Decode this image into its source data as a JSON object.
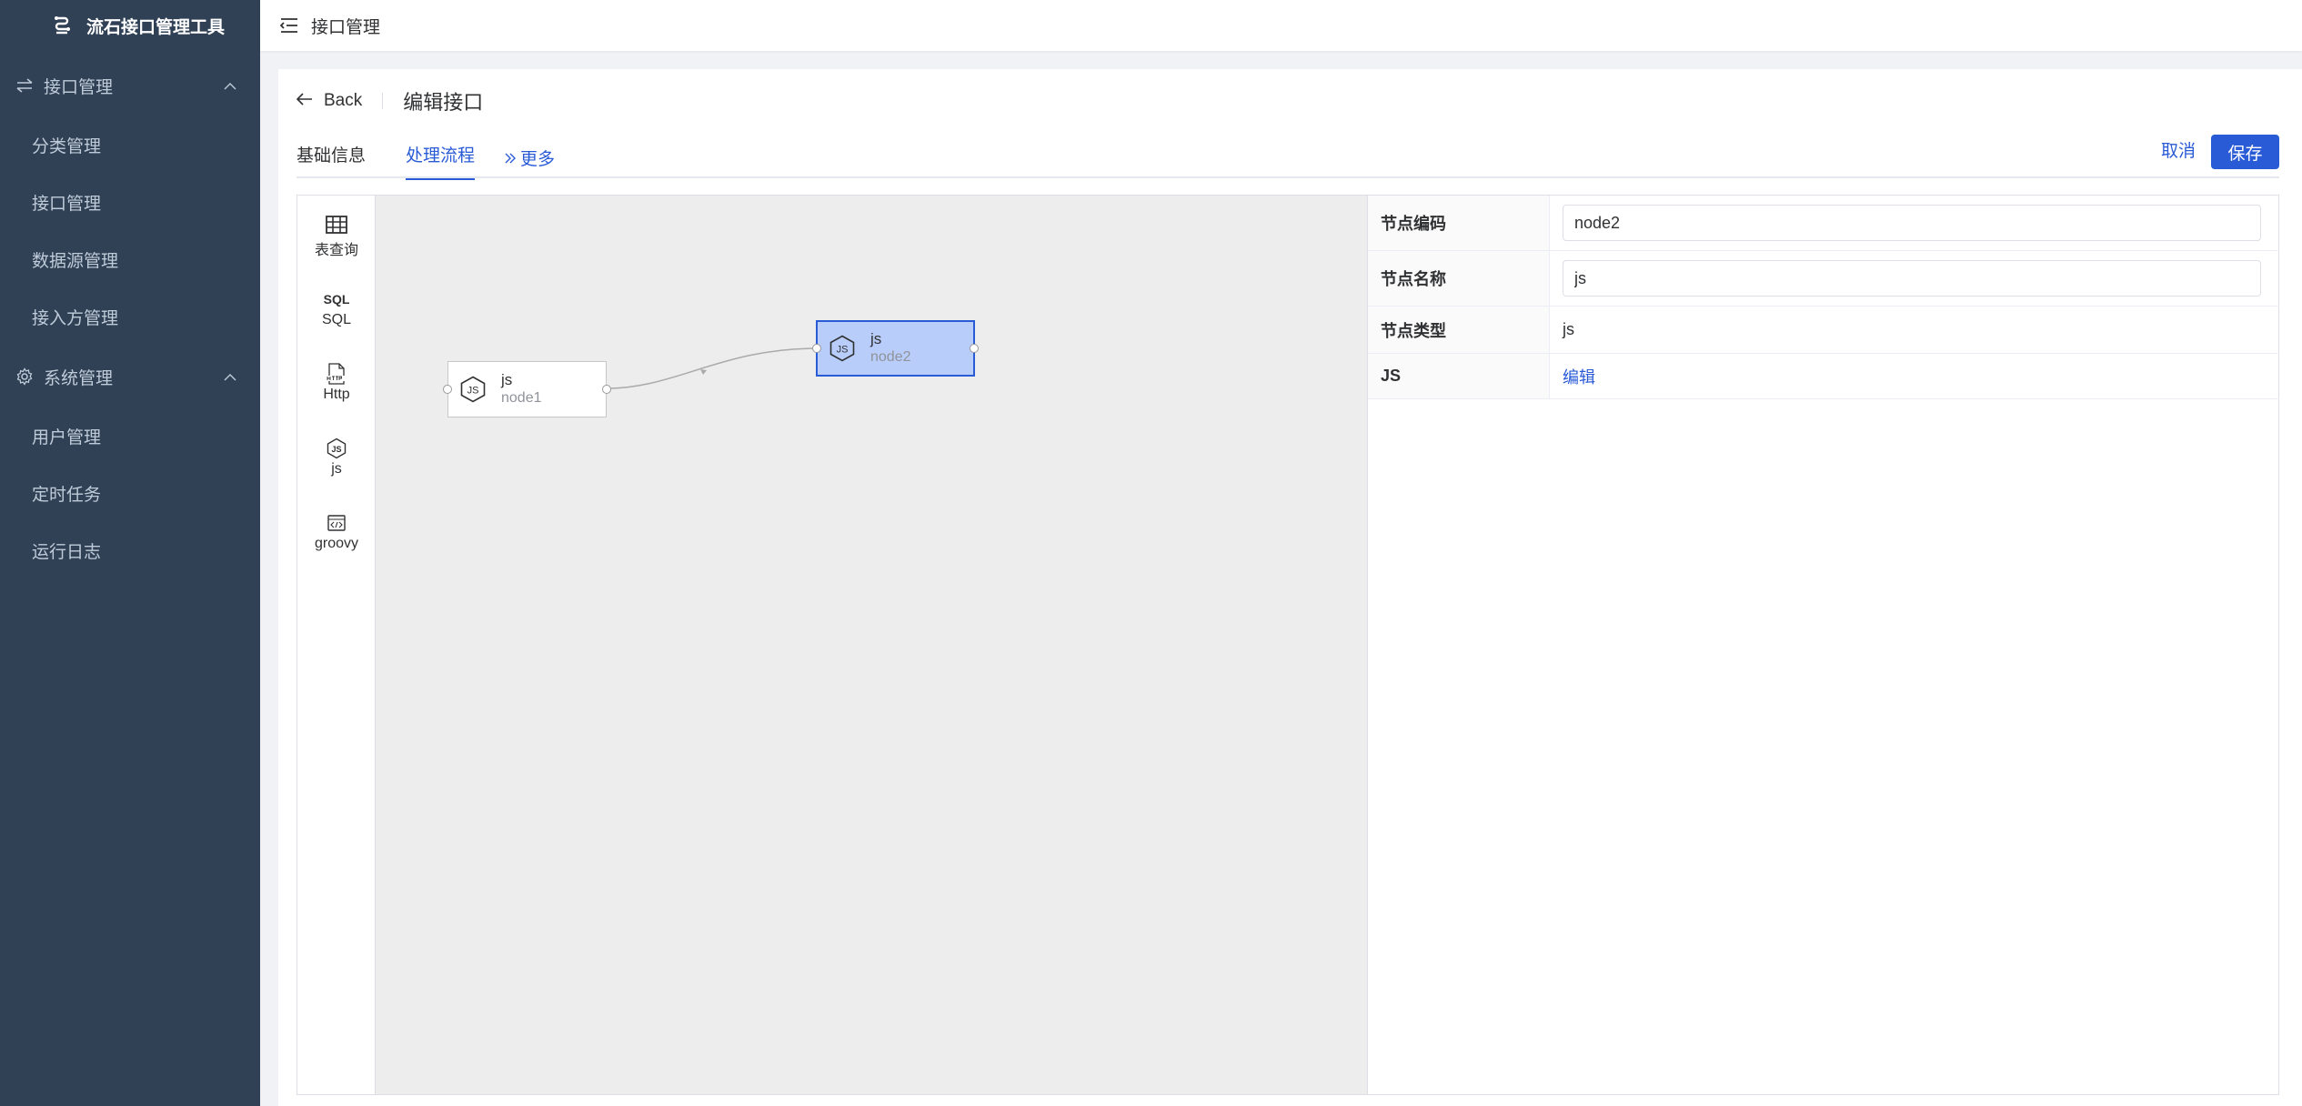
{
  "app": {
    "title": "流石接口管理工具"
  },
  "sidebar": {
    "groups": [
      {
        "label": "接口管理",
        "icon": "swap-icon",
        "items": [
          "分类管理",
          "接口管理",
          "数据源管理",
          "接入方管理"
        ]
      },
      {
        "label": "系统管理",
        "icon": "gear-icon",
        "items": [
          "用户管理",
          "定时任务",
          "运行日志"
        ]
      }
    ]
  },
  "header": {
    "breadcrumb": "接口管理"
  },
  "page": {
    "back_label": "Back",
    "title": "编辑接口",
    "tabs": [
      "基础信息",
      "处理流程",
      "更多"
    ],
    "active_tab": "处理流程",
    "cancel_label": "取消",
    "save_label": "保存"
  },
  "palette": [
    {
      "label": "表查询",
      "icon": "table-icon"
    },
    {
      "label": "SQL",
      "icon": "sql-icon",
      "icon_text": "SQL"
    },
    {
      "label": "Http",
      "icon": "http-file-icon"
    },
    {
      "label": "js",
      "icon": "nodejs-icon"
    },
    {
      "label": "groovy",
      "icon": "code-icon"
    }
  ],
  "flow": {
    "nodes": [
      {
        "type": "js",
        "name": "node1",
        "selected": false
      },
      {
        "type": "js",
        "name": "node2",
        "selected": true
      }
    ],
    "edges": [
      {
        "from": "node1",
        "to": "node2"
      }
    ]
  },
  "properties": {
    "node_code_label": "节点编码",
    "node_code_value": "node2",
    "node_name_label": "节点名称",
    "node_name_value": "js",
    "node_type_label": "节点类型",
    "node_type_value": "js",
    "js_label": "JS",
    "js_action": "编辑"
  },
  "colors": {
    "sidebar_bg": "#304156",
    "primary": "#2a5bd7",
    "canvas_bg": "#ededed",
    "selected_node_bg": "#b9cdfb"
  }
}
